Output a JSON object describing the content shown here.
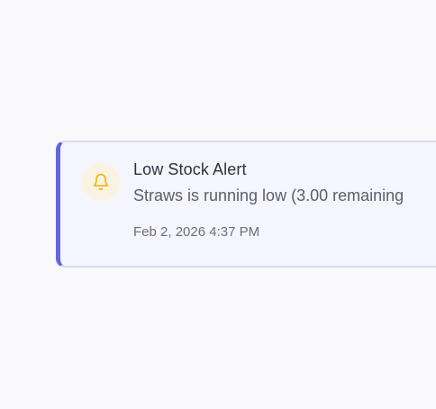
{
  "notification": {
    "icon": "bell-icon",
    "title": "Low Stock Alert",
    "message": "Straws is running low (3.00 remaining",
    "timestamp": "Feb 2, 2026 4:37 PM"
  },
  "colors": {
    "background": "#f9f9fb",
    "card_background": "#f5f5fd",
    "accent": "#6366e0",
    "icon_color": "#f2b705",
    "icon_background": "#fbf3e1"
  }
}
